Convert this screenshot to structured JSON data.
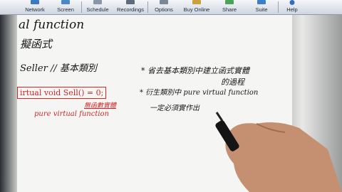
{
  "toolbar": {
    "items": [
      {
        "label": "Network"
      },
      {
        "label": "Screen"
      },
      {
        "label": "Schedule"
      },
      {
        "label": "Recordings"
      },
      {
        "label": "Options"
      },
      {
        "label": "Buy Online"
      },
      {
        "label": "Share"
      },
      {
        "label": "Suite"
      },
      {
        "label": "Help"
      }
    ]
  },
  "board": {
    "line1": "al function",
    "line2": "擬函式",
    "line3": "Seller // 基本類別",
    "code": "irtual void Sell() = 0;",
    "code_note_zh": "無函數實體",
    "code_note_en": "pure virtual function",
    "note1_a": "* 省去基本類別中建立函式實體",
    "note1_b": "的過程",
    "note2_a": "* 衍生類別中 pure virtual function",
    "note2_b": "一定必須實作出"
  },
  "colors": {
    "ink": "#161616",
    "red": "#cc2a2a"
  }
}
